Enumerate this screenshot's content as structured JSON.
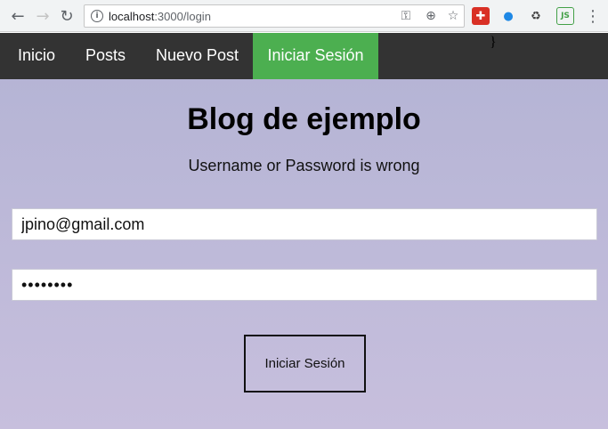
{
  "browser": {
    "url_host": "localhost",
    "url_path": ":3000/login",
    "back_glyph": "←",
    "forward_glyph": "→",
    "reload_glyph": "↻",
    "info_glyph": "i",
    "key_glyph": "⚿",
    "zoom_glyph": "⊕",
    "star_glyph": "☆",
    "menu_glyph": "⋮",
    "extensions": [
      {
        "name": "red-extension-icon",
        "glyph": "✚",
        "color": "#d93025"
      },
      {
        "name": "globe-extension-icon",
        "glyph": "●",
        "color": "#1e88e5"
      },
      {
        "name": "recycle-extension-icon",
        "glyph": "♻",
        "color": "#444444"
      },
      {
        "name": "nodejs-extension-icon",
        "glyph": "JS",
        "color": "#43a047"
      }
    ]
  },
  "navbar": {
    "items": [
      {
        "label": "Inicio"
      },
      {
        "label": "Posts"
      },
      {
        "label": "Nuevo Post"
      },
      {
        "label": "Iniciar Sesión",
        "active": true
      }
    ],
    "stray_text": "}",
    "bg_color": "#333333",
    "active_color": "#4caf50"
  },
  "main": {
    "title": "Blog de ejemplo",
    "error_message": "Username or Password is wrong",
    "email_value": "jpino@gmail.com",
    "password_value": "••••••••",
    "submit_label": "Iniciar Sesión"
  }
}
